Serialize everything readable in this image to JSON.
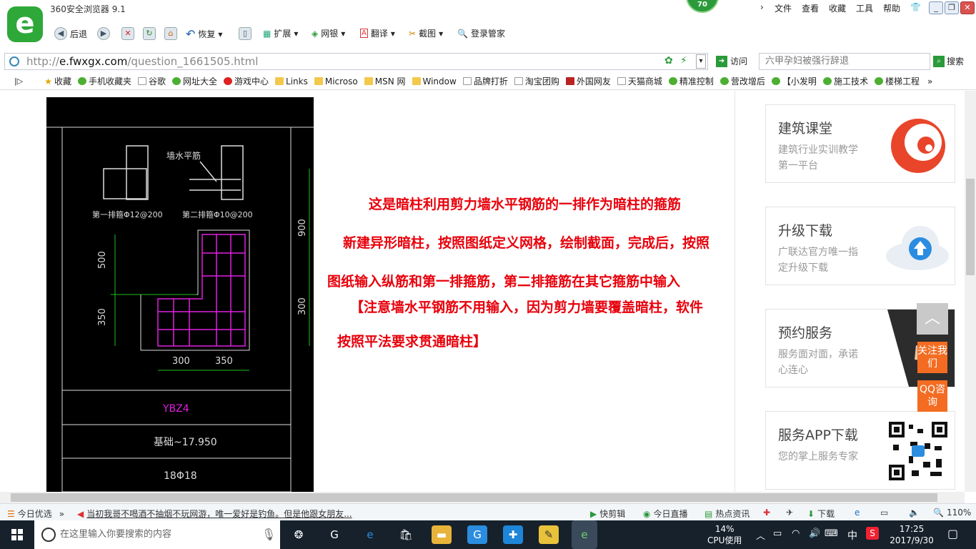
{
  "app": {
    "title": "360安全浏览器 9.1",
    "badge": "70",
    "menu": [
      "文件",
      "查看",
      "收藏",
      "工具",
      "帮助"
    ],
    "window_buttons": [
      "_",
      "❐",
      "✕"
    ]
  },
  "toolbar": {
    "back": "后退",
    "restore": "恢复",
    "extend": "扩展",
    "bank": "网银",
    "translate": "翻译",
    "screenshot": "截图",
    "login": "登录管家"
  },
  "address": {
    "prefix": "http://",
    "host": "e.fwxgx.com",
    "path": "/question_1661505.html",
    "visit": "访问"
  },
  "search": {
    "placeholder": "六甲孕妇被强行辞退",
    "button": "搜索"
  },
  "bookmarks": [
    "收藏",
    "手机收藏夹",
    "谷歌",
    "网址大全",
    "游戏中心",
    "Links",
    "Microso",
    "MSN 网",
    "Window",
    "品牌打折",
    "淘宝团购",
    "外国网友",
    "天猫商城",
    "精准控制",
    "营改增后",
    "【小发明",
    "施工技术",
    "楼梯工程"
  ],
  "cad": {
    "label_wall": "墙水平筋",
    "label_first": "第一排箍Φ12@200",
    "label_second": "第二排箍Φ10@200",
    "dim_500": "500",
    "dim_350": "350",
    "dim_900": "900",
    "dim_300v": "300",
    "dim_300": "300",
    "dim_350h": "350",
    "name": "YBZ4",
    "elevation": "基础~17.950",
    "bars": "18Φ18"
  },
  "article": {
    "lines": [
      "这是暗柱利用剪力墙水平钢筋的一排作为暗柱的箍筋",
      "新建异形暗柱，按照图纸定义网格，绘制截面，完成后，按照",
      "图纸输入纵筋和第一排箍筋，第二排箍筋在其它箍筋中输入",
      "【注意墙水平钢筋不用输入，因为剪力墙要覆盖暗柱，软件",
      "按照平法要求贯通暗柱】"
    ]
  },
  "sidebar": {
    "cards": [
      {
        "title": "建筑课堂",
        "desc": "建筑行业实训教学第一平台",
        "icon": "fire-logo-icon"
      },
      {
        "title": "升级下载",
        "desc": "广联达官方唯一指定升级下载",
        "icon": "cloud-upload-icon"
      },
      {
        "title": "预约服务",
        "desc": "服务面对面，承诺心连心",
        "icon": "handshake-icon"
      },
      {
        "title": "服务APP下载",
        "desc": "您的掌上服务专家",
        "icon": "qr-code-icon"
      }
    ],
    "follow": "关注我们",
    "qq": "QQ咨询"
  },
  "status": {
    "today": "今日优选",
    "news": "当初我哥不喝酒不抽烟不玩网游，唯一爱好是钓鱼。但是他跟女朋友...",
    "clip": "快剪辑",
    "live": "今日直播",
    "hot": "热点资讯",
    "download": "下载",
    "zoom": "110%"
  },
  "taskbar": {
    "search_placeholder": "在这里输入你要搜索的内容",
    "cpu_pct": "14%",
    "cpu_label": "CPU使用",
    "ime": "中",
    "time": "17:25",
    "date": "2017/9/30"
  },
  "colors": {
    "accent": "#2fa83a",
    "article": "#e8000b",
    "orange": "#f36c21",
    "cad_bg": "#000000",
    "cad_magenta": "#e020e0",
    "cad_green": "#20c020"
  }
}
